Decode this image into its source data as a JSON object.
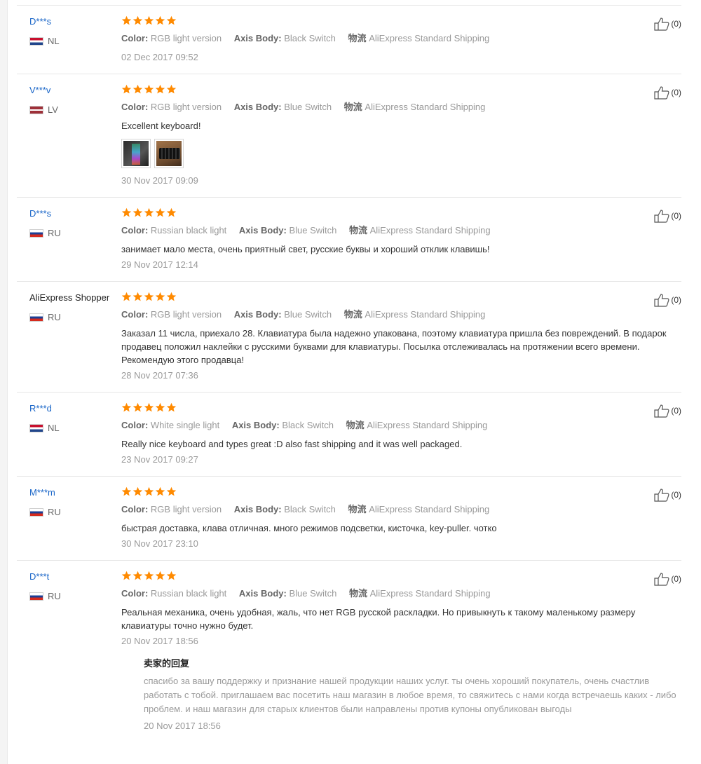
{
  "labels": {
    "color": "Color:",
    "axis_body": "Axis Body:",
    "shipping": "物流"
  },
  "colors": {
    "star": "#ff8a00",
    "buyer_link": "#1a66c8",
    "muted": "#999999"
  },
  "reviews": [
    {
      "buyer": "D***s",
      "country": "NL",
      "stars": 5,
      "color": "RGB light version",
      "axis_body": "Black Switch",
      "shipping": "AliExpress Standard Shipping",
      "text": "",
      "date": "02 Dec 2017 09:52",
      "likes": "(0)"
    },
    {
      "buyer": "V***v",
      "country": "LV",
      "stars": 5,
      "color": "RGB light version",
      "axis_body": "Blue Switch",
      "shipping": "AliExpress Standard Shipping",
      "text": "Excellent keyboard!",
      "photos": [
        "keyboard-photo-1",
        "keyboard-photo-2"
      ],
      "date": "30 Nov 2017 09:09",
      "likes": "(0)"
    },
    {
      "buyer": "D***s",
      "country": "RU",
      "stars": 5,
      "color": "Russian black light",
      "axis_body": "Blue Switch",
      "shipping": "AliExpress Standard Shipping",
      "text": "занимает мало места, очень приятный свет, русские буквы и хороший отклик клавишь!",
      "date": "29 Nov 2017 12:14",
      "likes": "(0)"
    },
    {
      "buyer": "AliExpress Shopper",
      "country": "RU",
      "stars": 5,
      "color": "RGB light version",
      "axis_body": "Blue Switch",
      "shipping": "AliExpress Standard Shipping",
      "text": "Заказал 11 числа, приехало 28. Клавиатура была надежно упакована, поэтому клавиатура пришла без повреждений. В подарок продавец положил наклейки с русскими буквами для клавиатуры. Посылка отслеживалась на протяжении всего времени. Рекомендую этого продавца!",
      "date": "28 Nov 2017 07:36",
      "likes": "(0)"
    },
    {
      "buyer": "R***d",
      "country": "NL",
      "stars": 5,
      "color": "White single light",
      "axis_body": "Black Switch",
      "shipping": "AliExpress Standard Shipping",
      "text": "Really nice keyboard and types great :D also fast shipping and it was well packaged.",
      "date": "23 Nov 2017 09:27",
      "likes": "(0)"
    },
    {
      "buyer": "M***m",
      "country": "RU",
      "stars": 5,
      "color": "RGB light version",
      "axis_body": "Black Switch",
      "shipping": "AliExpress Standard Shipping",
      "text": "быстрая доставка, клава отличная. много режимов подсветки, кисточка, key-puller. чотко",
      "date": "30 Nov 2017 23:10",
      "likes": "(0)"
    },
    {
      "buyer": "D***t",
      "country": "RU",
      "stars": 5,
      "color": "Russian black light",
      "axis_body": "Blue Switch",
      "shipping": "AliExpress Standard Shipping",
      "text": "Реальная механика, очень удобная, жаль, что нет RGB русской раскладки. Но привыкнуть к такому маленькому размеру клавиатуры точно нужно будет.",
      "date": "20 Nov 2017 18:56",
      "likes": "(0)",
      "reply": {
        "title": "卖家的回复",
        "text": "спасибо за вашу поддержку и признание нашей продукции наших услуг. ты очень хороший покупатель, очень счастлив работать с тобой. приглашаем вас посетить наш магазин в любое время, то свяжитесь с нами когда встречаешь каких - либо проблем. и наш магазин для старых клиентов были направлены против купоны опубликован выгоды",
        "date": "20 Nov 2017 18:56"
      }
    }
  ]
}
